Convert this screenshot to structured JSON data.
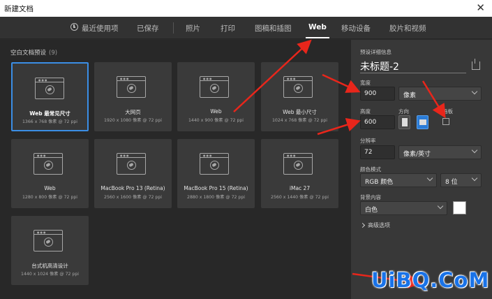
{
  "window": {
    "title": "新建文档",
    "close_glyph": "✕"
  },
  "tabs": [
    {
      "label": "最近使用项",
      "icon": "clock-icon"
    },
    {
      "label": "已保存"
    },
    {
      "label": "照片"
    },
    {
      "label": "打印"
    },
    {
      "label": "图稿和插图"
    },
    {
      "label": "Web",
      "active": true
    },
    {
      "label": "移动设备"
    },
    {
      "label": "胶片和视频"
    }
  ],
  "presets": {
    "title": "空白文档预设",
    "count": "(9)",
    "items": [
      {
        "name": "Web 最常见尺寸",
        "size": "1366 x 768 像素 @ 72 ppi",
        "selected": true
      },
      {
        "name": "大网页",
        "size": "1920 x 1080 像素 @ 72 ppi"
      },
      {
        "name": "Web",
        "size": "1440 x 900 像素 @ 72 ppi"
      },
      {
        "name": "Web 最小尺寸",
        "size": "1024 x 768 像素 @ 72 ppi"
      },
      {
        "name": "Web",
        "size": "1280 x 800 像素 @ 72 ppi"
      },
      {
        "name": "MacBook Pro 13 (Retina)",
        "size": "2560 x 1600 像素 @ 72 ppi"
      },
      {
        "name": "MacBook Pro 15 (Retina)",
        "size": "2880 x 1800 像素 @ 72 ppi"
      },
      {
        "name": "iMac 27",
        "size": "2560 x 1440 像素 @ 72 ppi"
      },
      {
        "name": "台式机高清设计",
        "size": "1440 x 1024 像素 @ 72 ppi"
      }
    ]
  },
  "details": {
    "header": "预设详细信息",
    "doc_name": "未标题-2",
    "width_label": "宽度",
    "width_value": "900",
    "width_unit": "像素",
    "height_label": "高度",
    "height_value": "600",
    "orientation_label": "方向",
    "artboard_label": "画板",
    "resolution_label": "分辨率",
    "resolution_value": "72",
    "resolution_unit": "像素/英寸",
    "color_mode_label": "颜色模式",
    "color_mode_value": "RGB 颜色",
    "bit_depth": "8 位",
    "background_label": "背景内容",
    "background_value": "白色",
    "background_color": "#ffffff",
    "advanced_label": "高级选项"
  },
  "watermark": {
    "text": "UiBQ.CoM",
    "color": "#1a73e8"
  },
  "colors": {
    "accent": "#3b8ee5",
    "arrow": "#e8261b"
  }
}
